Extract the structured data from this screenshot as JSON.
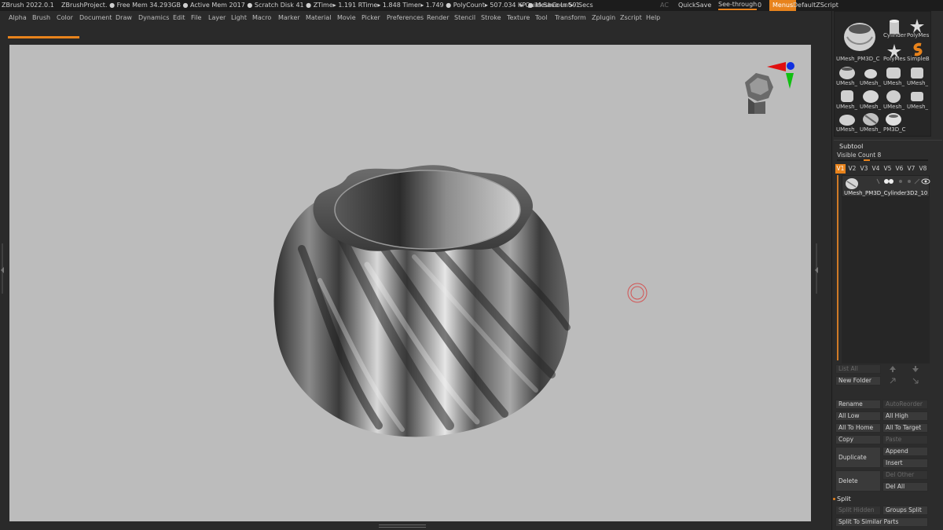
{
  "titlebar": {
    "app": "ZBrush 2022.0.1",
    "project": "ZBrushProject",
    "stats": ". ● Free Mem 34.293GB ● Active Mem 2017 ● Scratch Disk 41 ● ZTime▸ 1.191 RTime▸ 1.848 Timer▸ 1.749 ● PolyCount▸ 507.034 KP ● MeshCount▸ 1",
    "quicksave_status": "▸ QuickSave In 59 Secs",
    "ac": "AC",
    "quicksave": "QuickSave",
    "seethrough": "See-through",
    "seethrough_value": "0",
    "menus": "Menus",
    "script": "DefaultZScript"
  },
  "menubar": {
    "items": [
      "Alpha",
      "Brush",
      "Color",
      "Document",
      "Draw",
      "Dynamics",
      "Edit",
      "File",
      "Layer",
      "Light",
      "Macro",
      "Marker",
      "Material",
      "Movie",
      "Picker",
      "Preferences",
      "Render",
      "Stencil",
      "Stroke",
      "Texture",
      "Tool",
      "Transform",
      "Zplugin",
      "Zscript",
      "Help"
    ]
  },
  "tool_palette": {
    "main_label": "UMesh_PM3D_C",
    "items": [
      {
        "label": "Cylinder",
        "icon": "cylinder-icon"
      },
      {
        "label": "PolyMes",
        "icon": "star-icon"
      },
      {
        "label": "PolyMes",
        "icon": "star-icon"
      },
      {
        "label": "SimpleB",
        "icon": "simplebrush-icon"
      }
    ],
    "grid_labels": [
      "UMesh_",
      "UMesh_",
      "UMesh_",
      "UMesh_",
      "UMesh_",
      "UMesh_",
      "UMesh_",
      "UMesh_",
      "UMesh_",
      "UMesh_",
      "PM3D_C"
    ]
  },
  "subtool": {
    "title": "Subtool",
    "visible_count_label": "Visible Count 8",
    "visible_count_value": 8,
    "versions": [
      "V1",
      "V2",
      "V3",
      "V4",
      "V5",
      "V6",
      "V7",
      "V8"
    ],
    "active_version": "V1",
    "item_name": "UMesh_PM3D_Cylinder3D2_10",
    "buttons": {
      "list_all": "List All",
      "new_folder": "New Folder",
      "rename": "Rename",
      "auto_reorder": "AutoReorder",
      "all_low": "All Low",
      "all_high": "All High",
      "all_to_home": "All To Home",
      "all_to_target": "All To Target",
      "copy": "Copy",
      "paste": "Paste",
      "duplicate": "Duplicate",
      "append": "Append",
      "insert": "Insert",
      "delete": "Delete",
      "del_other": "Del Other",
      "del_all": "Del All"
    }
  },
  "split": {
    "title": "Split",
    "split_hidden": "Split Hidden",
    "groups_split": "Groups Split",
    "split_to_similar": "Split To Similar Parts"
  },
  "colors": {
    "accent": "#e8831c",
    "canvas": "#bcbcbc",
    "panel": "#2c2c2c"
  }
}
